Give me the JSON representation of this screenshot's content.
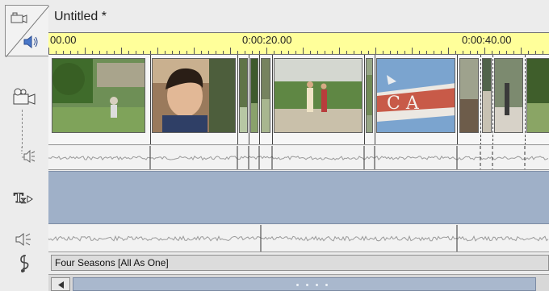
{
  "window": {
    "title": "Untitled *"
  },
  "ruler": {
    "labels": [
      "00.00",
      "0:00:20.00",
      "0:00:40.00"
    ]
  },
  "tracks": {
    "music": {
      "clip_label": "Four Seasons [All As One]"
    }
  },
  "colors": {
    "ruler_bg": "#ffff9a",
    "title_track_bg": "#9fb0c8",
    "scroll_thumb": "#a9b8cd"
  },
  "icons": [
    "camera-toggle-icon",
    "speaker-toggle-icon",
    "video-camera-icon",
    "video-audio-speaker-icon",
    "title-text-icon",
    "audio-speaker-icon",
    "music-note-icon",
    "scroll-left-arrow-icon"
  ]
}
